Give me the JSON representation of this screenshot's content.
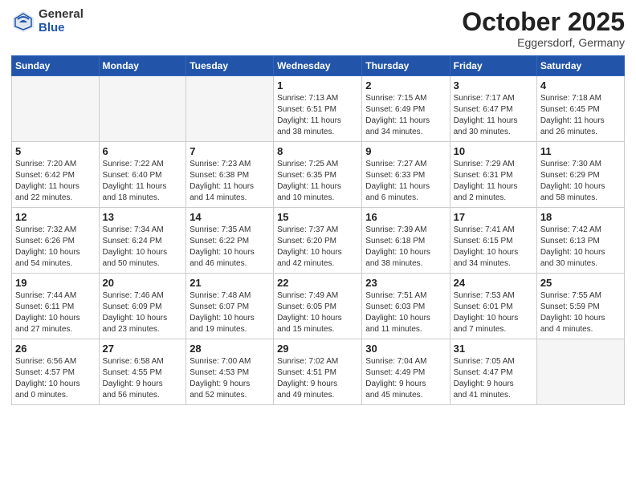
{
  "header": {
    "logo_general": "General",
    "logo_blue": "Blue",
    "month": "October 2025",
    "location": "Eggersdorf, Germany"
  },
  "weekdays": [
    "Sunday",
    "Monday",
    "Tuesday",
    "Wednesday",
    "Thursday",
    "Friday",
    "Saturday"
  ],
  "weeks": [
    [
      {
        "day": "",
        "info": ""
      },
      {
        "day": "",
        "info": ""
      },
      {
        "day": "",
        "info": ""
      },
      {
        "day": "1",
        "info": "Sunrise: 7:13 AM\nSunset: 6:51 PM\nDaylight: 11 hours\nand 38 minutes."
      },
      {
        "day": "2",
        "info": "Sunrise: 7:15 AM\nSunset: 6:49 PM\nDaylight: 11 hours\nand 34 minutes."
      },
      {
        "day": "3",
        "info": "Sunrise: 7:17 AM\nSunset: 6:47 PM\nDaylight: 11 hours\nand 30 minutes."
      },
      {
        "day": "4",
        "info": "Sunrise: 7:18 AM\nSunset: 6:45 PM\nDaylight: 11 hours\nand 26 minutes."
      }
    ],
    [
      {
        "day": "5",
        "info": "Sunrise: 7:20 AM\nSunset: 6:42 PM\nDaylight: 11 hours\nand 22 minutes."
      },
      {
        "day": "6",
        "info": "Sunrise: 7:22 AM\nSunset: 6:40 PM\nDaylight: 11 hours\nand 18 minutes."
      },
      {
        "day": "7",
        "info": "Sunrise: 7:23 AM\nSunset: 6:38 PM\nDaylight: 11 hours\nand 14 minutes."
      },
      {
        "day": "8",
        "info": "Sunrise: 7:25 AM\nSunset: 6:35 PM\nDaylight: 11 hours\nand 10 minutes."
      },
      {
        "day": "9",
        "info": "Sunrise: 7:27 AM\nSunset: 6:33 PM\nDaylight: 11 hours\nand 6 minutes."
      },
      {
        "day": "10",
        "info": "Sunrise: 7:29 AM\nSunset: 6:31 PM\nDaylight: 11 hours\nand 2 minutes."
      },
      {
        "day": "11",
        "info": "Sunrise: 7:30 AM\nSunset: 6:29 PM\nDaylight: 10 hours\nand 58 minutes."
      }
    ],
    [
      {
        "day": "12",
        "info": "Sunrise: 7:32 AM\nSunset: 6:26 PM\nDaylight: 10 hours\nand 54 minutes."
      },
      {
        "day": "13",
        "info": "Sunrise: 7:34 AM\nSunset: 6:24 PM\nDaylight: 10 hours\nand 50 minutes."
      },
      {
        "day": "14",
        "info": "Sunrise: 7:35 AM\nSunset: 6:22 PM\nDaylight: 10 hours\nand 46 minutes."
      },
      {
        "day": "15",
        "info": "Sunrise: 7:37 AM\nSunset: 6:20 PM\nDaylight: 10 hours\nand 42 minutes."
      },
      {
        "day": "16",
        "info": "Sunrise: 7:39 AM\nSunset: 6:18 PM\nDaylight: 10 hours\nand 38 minutes."
      },
      {
        "day": "17",
        "info": "Sunrise: 7:41 AM\nSunset: 6:15 PM\nDaylight: 10 hours\nand 34 minutes."
      },
      {
        "day": "18",
        "info": "Sunrise: 7:42 AM\nSunset: 6:13 PM\nDaylight: 10 hours\nand 30 minutes."
      }
    ],
    [
      {
        "day": "19",
        "info": "Sunrise: 7:44 AM\nSunset: 6:11 PM\nDaylight: 10 hours\nand 27 minutes."
      },
      {
        "day": "20",
        "info": "Sunrise: 7:46 AM\nSunset: 6:09 PM\nDaylight: 10 hours\nand 23 minutes."
      },
      {
        "day": "21",
        "info": "Sunrise: 7:48 AM\nSunset: 6:07 PM\nDaylight: 10 hours\nand 19 minutes."
      },
      {
        "day": "22",
        "info": "Sunrise: 7:49 AM\nSunset: 6:05 PM\nDaylight: 10 hours\nand 15 minutes."
      },
      {
        "day": "23",
        "info": "Sunrise: 7:51 AM\nSunset: 6:03 PM\nDaylight: 10 hours\nand 11 minutes."
      },
      {
        "day": "24",
        "info": "Sunrise: 7:53 AM\nSunset: 6:01 PM\nDaylight: 10 hours\nand 7 minutes."
      },
      {
        "day": "25",
        "info": "Sunrise: 7:55 AM\nSunset: 5:59 PM\nDaylight: 10 hours\nand 4 minutes."
      }
    ],
    [
      {
        "day": "26",
        "info": "Sunrise: 6:56 AM\nSunset: 4:57 PM\nDaylight: 10 hours\nand 0 minutes."
      },
      {
        "day": "27",
        "info": "Sunrise: 6:58 AM\nSunset: 4:55 PM\nDaylight: 9 hours\nand 56 minutes."
      },
      {
        "day": "28",
        "info": "Sunrise: 7:00 AM\nSunset: 4:53 PM\nDaylight: 9 hours\nand 52 minutes."
      },
      {
        "day": "29",
        "info": "Sunrise: 7:02 AM\nSunset: 4:51 PM\nDaylight: 9 hours\nand 49 minutes."
      },
      {
        "day": "30",
        "info": "Sunrise: 7:04 AM\nSunset: 4:49 PM\nDaylight: 9 hours\nand 45 minutes."
      },
      {
        "day": "31",
        "info": "Sunrise: 7:05 AM\nSunset: 4:47 PM\nDaylight: 9 hours\nand 41 minutes."
      },
      {
        "day": "",
        "info": ""
      }
    ]
  ]
}
